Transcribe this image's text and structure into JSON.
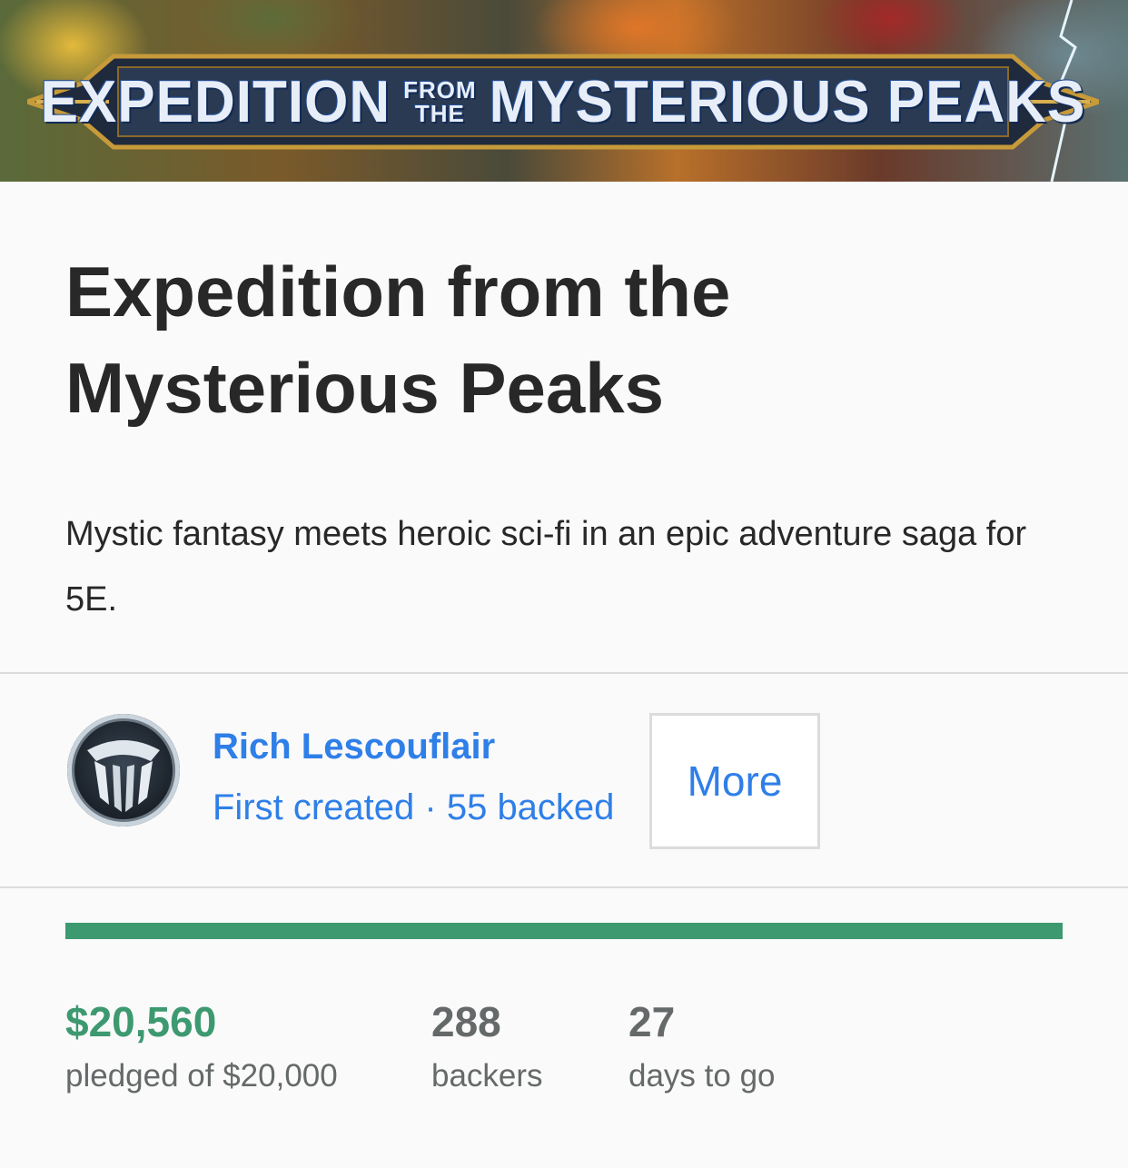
{
  "hero": {
    "banner_words": [
      "EXPEDITION",
      "FROM",
      "THE",
      "MYSTERIOUS PEAKS"
    ]
  },
  "project": {
    "title": "Expedition from the Mysterious Peaks",
    "blurb": "Mystic fantasy meets heroic sci-fi in an epic adventure saga for 5E."
  },
  "creator": {
    "name": "Rich Lescouflair",
    "meta": "First created · 55 backed",
    "more_label": "More"
  },
  "funding": {
    "progress_fraction": 1.0,
    "pledged": "$20,560",
    "pledged_label": "pledged of $20,000",
    "backers": "288",
    "backers_label": "backers",
    "days": "27",
    "days_label": "days to go"
  },
  "colors": {
    "accent_green": "#3d9970",
    "link_blue": "#2f7fe8",
    "text_dark": "#282828",
    "text_muted": "#656969"
  }
}
